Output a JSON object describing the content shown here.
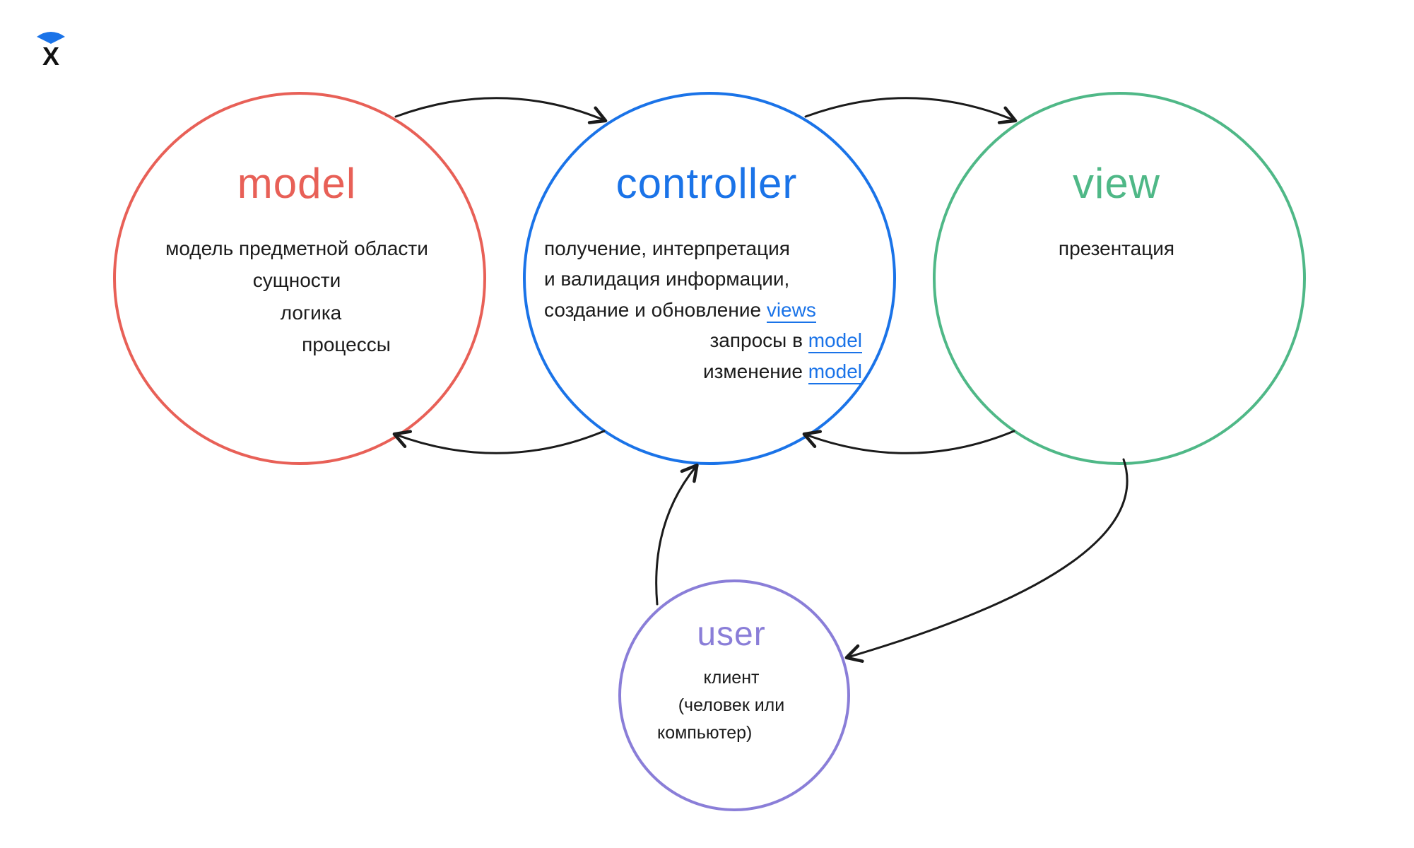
{
  "nodes": {
    "model": {
      "title": "model",
      "line1": "модель предметной области",
      "line2": "сущности",
      "line3": "логика",
      "line4": "процессы"
    },
    "controller": {
      "title": "controller",
      "line1": "получение, интерпретация",
      "line2": "и валидация информации,",
      "line3a": "создание и обновление ",
      "line3b": "views",
      "line4a": "запросы в ",
      "line4b": "model",
      "line5a": "изменение ",
      "line5b": "model"
    },
    "view": {
      "title": "view",
      "line1": "презентация"
    },
    "user": {
      "title": "user",
      "line1": "клиент",
      "line2": "(человек или",
      "line3": "компьютер)"
    }
  },
  "colors": {
    "model": "#e86057",
    "controller": "#1a73e8",
    "view": "#4fb887",
    "user": "#8a7ed8",
    "text": "#1b1b1b"
  },
  "arrows": [
    {
      "from": "model",
      "to": "controller",
      "dir": "top-forward"
    },
    {
      "from": "controller",
      "to": "model",
      "dir": "bottom-back"
    },
    {
      "from": "controller",
      "to": "view",
      "dir": "top-forward"
    },
    {
      "from": "view",
      "to": "controller",
      "dir": "bottom-back"
    },
    {
      "from": "user",
      "to": "controller",
      "dir": "up"
    },
    {
      "from": "view",
      "to": "user",
      "dir": "down"
    }
  ]
}
